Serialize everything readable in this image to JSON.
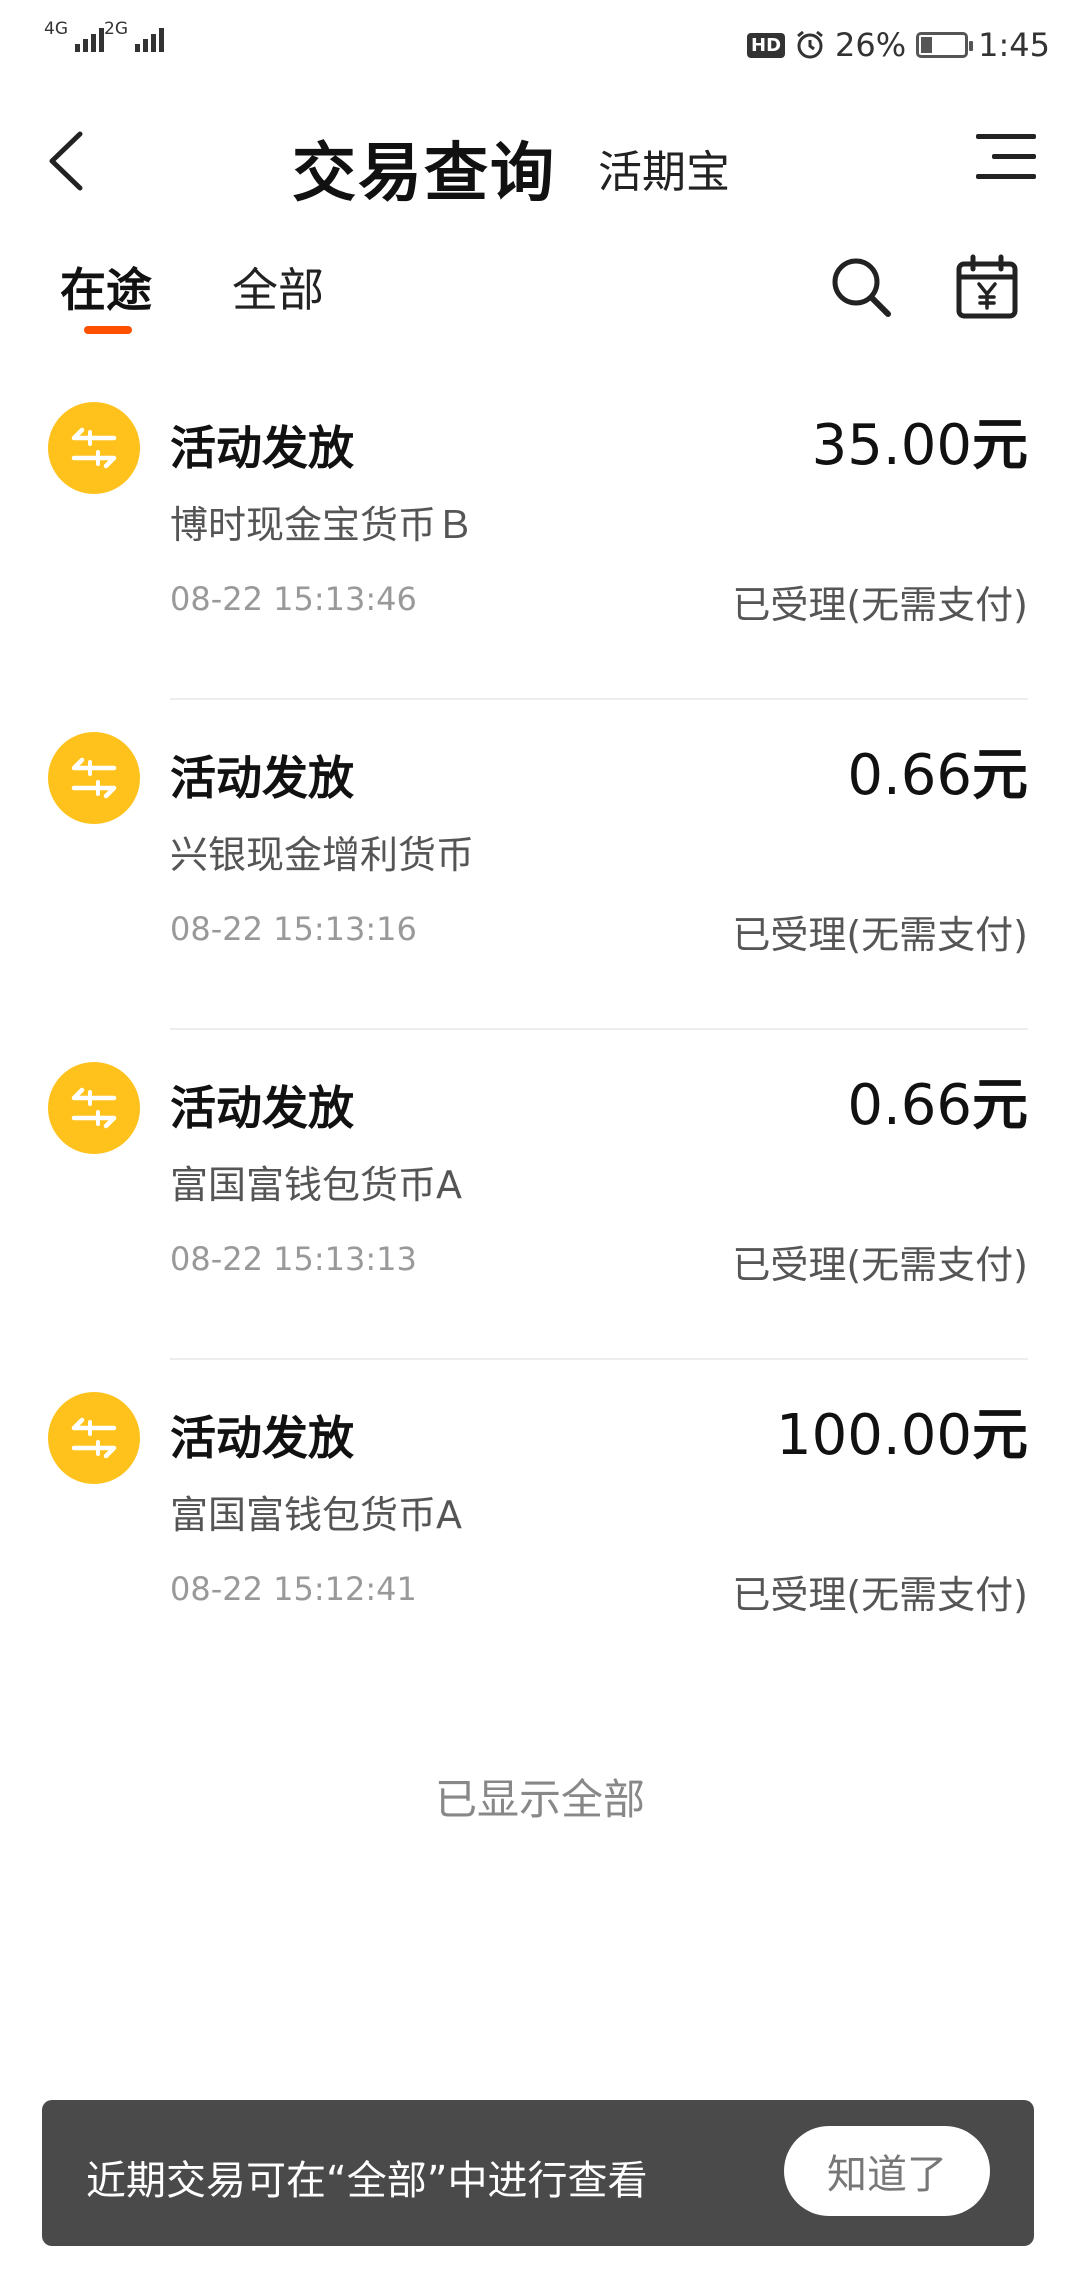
{
  "status_bar": {
    "sim1_network": "4G",
    "sim2_network": "2G",
    "hd_badge": "HD",
    "battery_text": "26%",
    "battery_level": 0.26,
    "time": "1:45"
  },
  "header": {
    "title": "交易查询",
    "subtitle": "活期宝"
  },
  "tabs": [
    {
      "label": "在途",
      "active": true
    },
    {
      "label": "全部",
      "active": false
    }
  ],
  "transactions": [
    {
      "title": "活动发放",
      "amount": "35.00",
      "unit": "元",
      "fund": "博时现金宝货币Ｂ",
      "time": "08-22 15:13:46",
      "status": "已受理(无需支付)"
    },
    {
      "title": "活动发放",
      "amount": "0.66",
      "unit": "元",
      "fund": "兴银现金增利货币",
      "time": "08-22 15:13:16",
      "status": "已受理(无需支付)"
    },
    {
      "title": "活动发放",
      "amount": "0.66",
      "unit": "元",
      "fund": "富国富钱包货币A",
      "time": "08-22 15:13:13",
      "status": "已受理(无需支付)"
    },
    {
      "title": "活动发放",
      "amount": "100.00",
      "unit": "元",
      "fund": "富国富钱包货币A",
      "time": "08-22 15:12:41",
      "status": "已受理(无需支付)"
    }
  ],
  "footer_text": "已显示全部",
  "toast": {
    "message": "近期交易可在“全部”中进行查看",
    "button": "知道了"
  },
  "colors": {
    "accent": "#ff5000",
    "icon_bg": "#ffc21c",
    "toast_bg": "#4a4a4a"
  }
}
